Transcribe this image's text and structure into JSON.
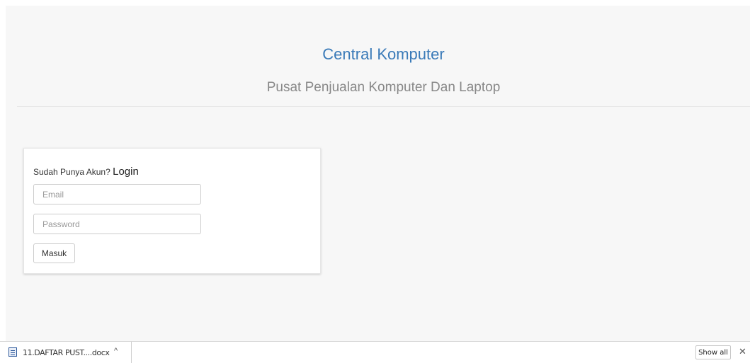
{
  "header": {
    "title": "Central Komputer",
    "subtitle": "Pusat Penjualan Komputer Dan Laptop"
  },
  "login": {
    "prompt": "Sudah Punya Akun?",
    "heading": "Login",
    "email_placeholder": "Email",
    "password_placeholder": "Password",
    "submit_label": "Masuk"
  },
  "download_bar": {
    "file_name": "11.DAFTAR PUST....docx",
    "file_icon": "word-document-icon",
    "chevron": "^",
    "show_all_label": "Show all",
    "close_label": "✕"
  }
}
